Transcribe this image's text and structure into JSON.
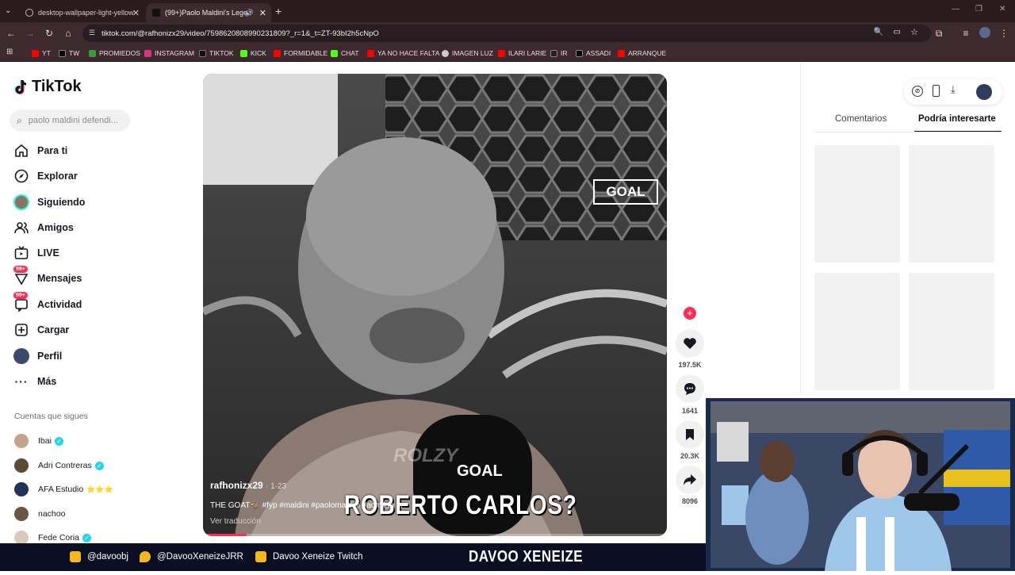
{
  "browser": {
    "tabs": [
      {
        "title": "desktop-wallpaper-light-yellow",
        "active": false
      },
      {
        "title": "(99+)Paolo Maldini's Legen",
        "active": true
      }
    ],
    "url": "tiktok.com/@rafhonizx29/video/7598620808990231809?_r=1&_t=ZT-93bI2h5cNpO",
    "bookmarks": [
      "YT",
      "TW",
      "PROMIEDOS",
      "INSTAGRAM",
      "TIKTOK",
      "KICK",
      "FORMIDABLE",
      "CHAT",
      "YA NO HACE FALTA",
      "IMAGEN LUZ",
      "ILARI LARIE",
      "IR",
      "ASSADI",
      "ARRANQUE"
    ]
  },
  "tiktok": {
    "logo": "TikTok",
    "search_placeholder": "paolo maldini defendi...",
    "nav": [
      {
        "label": "Para ti",
        "icon": "home-icon"
      },
      {
        "label": "Explorar",
        "icon": "compass-icon"
      },
      {
        "label": "Siguiendo",
        "icon": "avatar-icon"
      },
      {
        "label": "Amigos",
        "icon": "friends-icon"
      },
      {
        "label": "LIVE",
        "icon": "live-tv-icon"
      },
      {
        "label": "Mensajes",
        "icon": "inbox-icon",
        "badge": "99+"
      },
      {
        "label": "Actividad",
        "icon": "activity-icon",
        "badge": "99+"
      },
      {
        "label": "Cargar",
        "icon": "upload-icon"
      },
      {
        "label": "Perfil",
        "icon": "profile-icon"
      },
      {
        "label": "Más",
        "icon": "more-icon"
      }
    ],
    "following_title": "Cuentas que sigues",
    "accounts": [
      {
        "name": "Ibai",
        "verified": true
      },
      {
        "name": "Adri Contreras",
        "verified": true
      },
      {
        "name": "AFA Estudio",
        "stars": "⭐⭐⭐"
      },
      {
        "name": "nachoo",
        "verified": false
      },
      {
        "name": "Fede Coria",
        "verified": true
      }
    ]
  },
  "video": {
    "author": "rafhonizx29",
    "date": "· 1-23",
    "caption": "THE GOAT🐐 #fyp #maldini #paolomaldini #acmilan ...",
    "translate": "Ver traducción",
    "overlay_logo": "GOAL",
    "mic_logo": "GOAL",
    "subtitle": "ROBERTO CARLOS?",
    "watermark": "ROLZY"
  },
  "actions": {
    "likes": "197.5K",
    "comments": "1641",
    "saves": "20.3K",
    "shares": "8096"
  },
  "right_panel": {
    "tabs": [
      "Comentarios",
      "Podría interesarte"
    ],
    "active_tab": "Podría interesarte"
  },
  "stream_overlay": {
    "instagram": "@davoobj",
    "twitter": "@DavooXeneizeJRR",
    "youtube": "Davoo Xeneize Twitch",
    "title": "DAVOO XENEIZE"
  },
  "colors": {
    "accent": "#fe2c55",
    "chrome_dark": "#3d2a2f",
    "overlay_bar": "#0a0f24"
  }
}
